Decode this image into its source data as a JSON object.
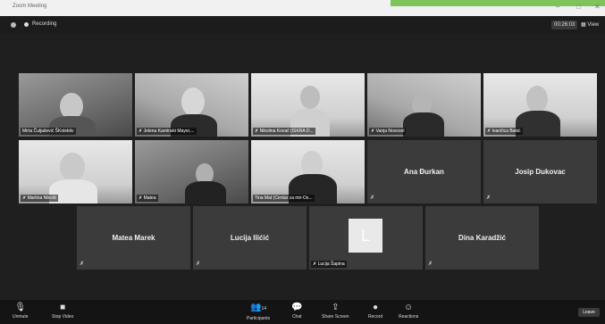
{
  "window": {
    "title": "Zoom Meeting",
    "controls": [
      "–",
      "□",
      "✕"
    ],
    "accent_color": "#7ec45a"
  },
  "topbar": {
    "recording_label": "Recording",
    "timer": "00:26:03",
    "view_label": "View"
  },
  "participants": [
    {
      "name": "Mirta Čuljašević ŠKolektiv",
      "type": "video",
      "muted": false
    },
    {
      "name": "Jelena Kaminski Mayer,...",
      "type": "video",
      "muted": true
    },
    {
      "name": "Nikolina Kovač (ISKRA D...",
      "type": "video",
      "muted": true
    },
    {
      "name": "Vanja Novosel",
      "type": "video",
      "muted": true
    },
    {
      "name": "Ivančica Bakić",
      "type": "video",
      "muted": true
    },
    {
      "name": "Martina Nikolić",
      "type": "video",
      "muted": true
    },
    {
      "name": "Matea",
      "type": "video",
      "muted": true
    },
    {
      "name": "Tina Mat (Centar za mir-Os...",
      "type": "video",
      "muted": false
    },
    {
      "name": "Ana Đurkan",
      "type": "name",
      "muted": true
    },
    {
      "name": "Josip Dukovac",
      "type": "name",
      "muted": true
    },
    {
      "name": "Matea Marek",
      "type": "name",
      "muted": true
    },
    {
      "name": "Lucija Ilićić",
      "type": "name",
      "muted": true
    },
    {
      "name": "Lucija Šapina",
      "type": "avatar",
      "initial": "L",
      "muted": true
    },
    {
      "name": "Dina Karadžić",
      "type": "name",
      "muted": true
    }
  ],
  "toolbar": {
    "unmute": "Unmute",
    "stop_video": "Stop Video",
    "participants": "Participants",
    "participants_count": "14",
    "chat": "Chat",
    "share_screen": "Share Screen",
    "record": "Record",
    "reactions": "Reactions",
    "leave": "Leave"
  }
}
